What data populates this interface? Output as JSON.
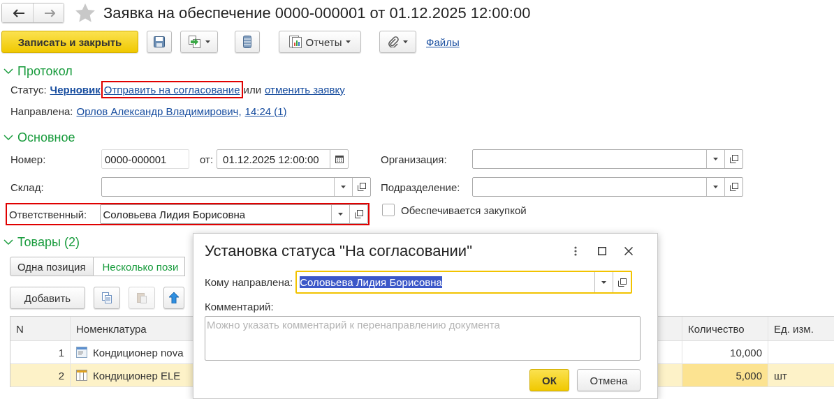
{
  "window": {
    "title": "Заявка на обеспечение 0000-000001 от 01.12.2025 12:00:00",
    "favorite": false
  },
  "toolbar": {
    "primary": "Записать и закрыть",
    "reports": "Отчеты",
    "files_link": "Файлы"
  },
  "protocol": {
    "title": "Протокол",
    "expanded": true,
    "status_label": "Статус:",
    "status_value": "Черновик",
    "action_link": {
      "text": "Отправить на согласование",
      "highlighted": true
    },
    "conjunction": "или",
    "cancel_link": "отменить заявку",
    "sent_label": "Направлена:",
    "sent_to": "Орлов Александр Владимирович,",
    "sent_time": "14:24 (1)"
  },
  "main": {
    "title": "Основное",
    "expanded": true,
    "number_label": "Номер:",
    "number": "0000-000001",
    "date_label": "от:",
    "date": "01.12.2025 12:00:00",
    "warehouse_label": "Склад:",
    "responsible": {
      "label": "Ответственный:",
      "value": "Соловьева Лидия Борисовна",
      "highlighted": true
    },
    "organization_label": "Организация:",
    "subdivision_label": "Подразделение:",
    "purchase": {
      "label": "Обеспечивается закупкой",
      "checked": false
    }
  },
  "goods": {
    "title": "Товары (2)",
    "expanded": true,
    "tabs": [
      {
        "label": "Одна позиция",
        "selected": false
      },
      {
        "label": "Несколько пози",
        "selected": true
      }
    ],
    "add_button": "Добавить",
    "table": {
      "columns": [
        "N",
        "Номенклатура",
        "Количество",
        "Ед. изм."
      ],
      "rows": [
        {
          "n": "1",
          "kind": "product",
          "item": "Кондиционер nova",
          "quantity": "10,000",
          "selected": false
        },
        {
          "n": "2",
          "kind": "set",
          "item": "Кондиционер ELE",
          "quantity": "5,000",
          "unit": "шт",
          "selected": true
        }
      ]
    }
  },
  "dialog": {
    "title": "Установка статуса \"На согласовании\"",
    "recipient_label": "Кому направлена:",
    "recipient": {
      "value": "Соловьева Лидия Борисовна",
      "selected": true
    },
    "comment_label": "Комментарий:",
    "comment_placeholder": "Можно указать комментарий к перенаправлению документа",
    "ok": "ОК",
    "cancel": "Отмена"
  }
}
